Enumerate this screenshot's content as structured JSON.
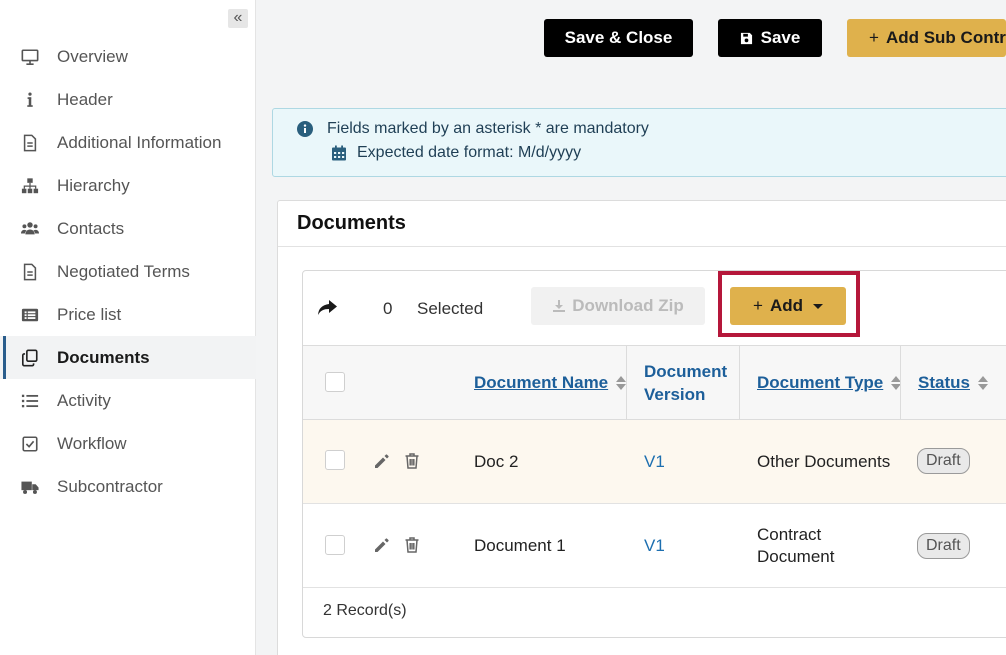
{
  "sidebar": {
    "collapse_glyph": "«",
    "items": [
      {
        "label": "Overview",
        "icon": "monitor-icon",
        "active": false
      },
      {
        "label": "Header",
        "icon": "info-icon",
        "active": false
      },
      {
        "label": "Additional Information",
        "icon": "file-icon",
        "active": false
      },
      {
        "label": "Hierarchy",
        "icon": "hierarchy-icon",
        "active": false
      },
      {
        "label": "Contacts",
        "icon": "users-icon",
        "active": false
      },
      {
        "label": "Negotiated Terms",
        "icon": "file-icon",
        "active": false
      },
      {
        "label": "Price list",
        "icon": "list-alt-icon",
        "active": false
      },
      {
        "label": "Documents",
        "icon": "copy-icon",
        "active": true
      },
      {
        "label": "Activity",
        "icon": "list-icon",
        "active": false
      },
      {
        "label": "Workflow",
        "icon": "check-square-icon",
        "active": false
      },
      {
        "label": "Subcontractor",
        "icon": "truck-icon",
        "active": false
      }
    ]
  },
  "toolbar": {
    "save_close_label": "Save & Close",
    "save_label": "Save",
    "add_sub_label": "Add Sub Contra"
  },
  "info": {
    "line1": "Fields marked by an asterisk * are mandatory",
    "line2": "Expected date format: M/d/yyyy"
  },
  "documents": {
    "title": "Documents",
    "selected_count": "0",
    "selected_label": "Selected",
    "download_zip_label": "Download Zip",
    "add_label": "Add",
    "columns": {
      "name": "Document Name",
      "version": "Document Version",
      "type": "Document Type",
      "status": "Status"
    },
    "rows": [
      {
        "name": "Doc 2",
        "version": "V1",
        "type": "Other Documents",
        "status": "Draft"
      },
      {
        "name": "Document 1",
        "version": "V1",
        "type": "Contract Document",
        "status": "Draft"
      }
    ],
    "footer": "2 Record(s)"
  },
  "colors": {
    "accent_gold": "#dfb14c",
    "highlight_frame": "#b5173a",
    "link_blue": "#1d5f9a"
  }
}
